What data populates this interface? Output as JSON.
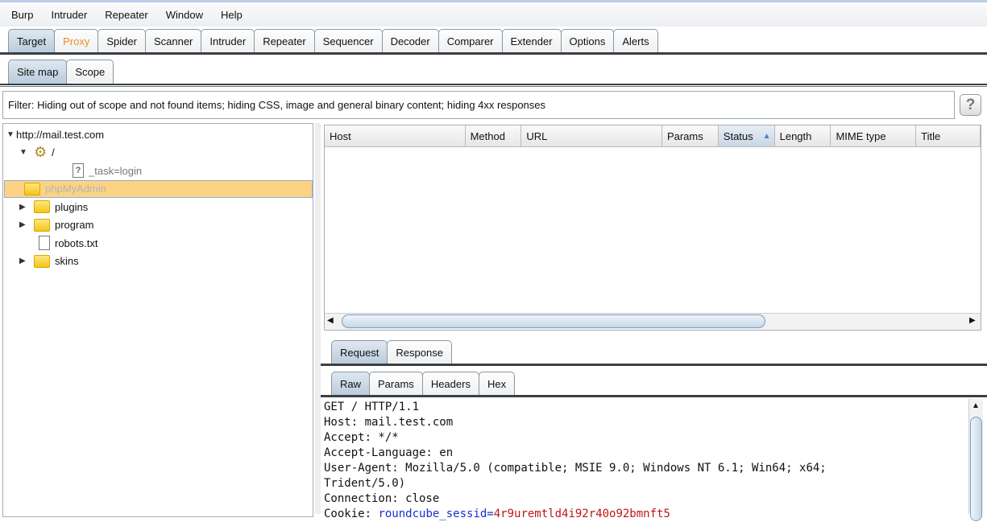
{
  "menu": [
    "Burp",
    "Intruder",
    "Repeater",
    "Window",
    "Help"
  ],
  "main_tabs": [
    "Target",
    "Proxy",
    "Spider",
    "Scanner",
    "Intruder",
    "Repeater",
    "Sequencer",
    "Decoder",
    "Comparer",
    "Extender",
    "Options",
    "Alerts"
  ],
  "sub_tabs": [
    "Site map",
    "Scope"
  ],
  "filter": "Filter:  Hiding out of scope and not found items;  hiding CSS, image and general binary content;  hiding 4xx responses",
  "help_label": "?",
  "tree": [
    {
      "label": "http://mail.test.com",
      "toggle": "▼",
      "icon": "none"
    },
    {
      "label": "/",
      "toggle": "▼",
      "icon": "gear"
    },
    {
      "label": "_task=login",
      "toggle": "",
      "icon": "unknown-file"
    },
    {
      "label": "phpMyAdmin",
      "toggle": "",
      "icon": "folder",
      "selected": true
    },
    {
      "label": "plugins",
      "toggle": "▶",
      "icon": "folder"
    },
    {
      "label": "program",
      "toggle": "▶",
      "icon": "folder"
    },
    {
      "label": "robots.txt",
      "toggle": "",
      "icon": "file"
    },
    {
      "label": "skins",
      "toggle": "▶",
      "icon": "folder"
    }
  ],
  "table": {
    "columns": [
      "Host",
      "Method",
      "URL",
      "Params",
      "Status",
      "Length",
      "MIME type",
      "Title"
    ],
    "sorted": "Status",
    "sort_arrow": "▲"
  },
  "request_tabs": [
    "Request",
    "Response"
  ],
  "view_tabs": [
    "Raw",
    "Params",
    "Headers",
    "Hex"
  ],
  "request_lines": [
    "GET / HTTP/1.1",
    "Host: mail.test.com",
    "Accept: */*",
    "Accept-Language: en",
    "User-Agent: Mozilla/5.0 (compatible; MSIE 9.0; Windows NT 6.1; Win64; x64;",
    "Trident/5.0)",
    "Connection: close"
  ],
  "cookie": {
    "label": "Cookie: ",
    "name": "roundcube_sessid",
    "eq": "=",
    "value": "4r9uremtld4i92r40o92bmnft5"
  },
  "colors": {
    "proxy_tab": "#e8901c",
    "selected_row": "#fdd283"
  }
}
